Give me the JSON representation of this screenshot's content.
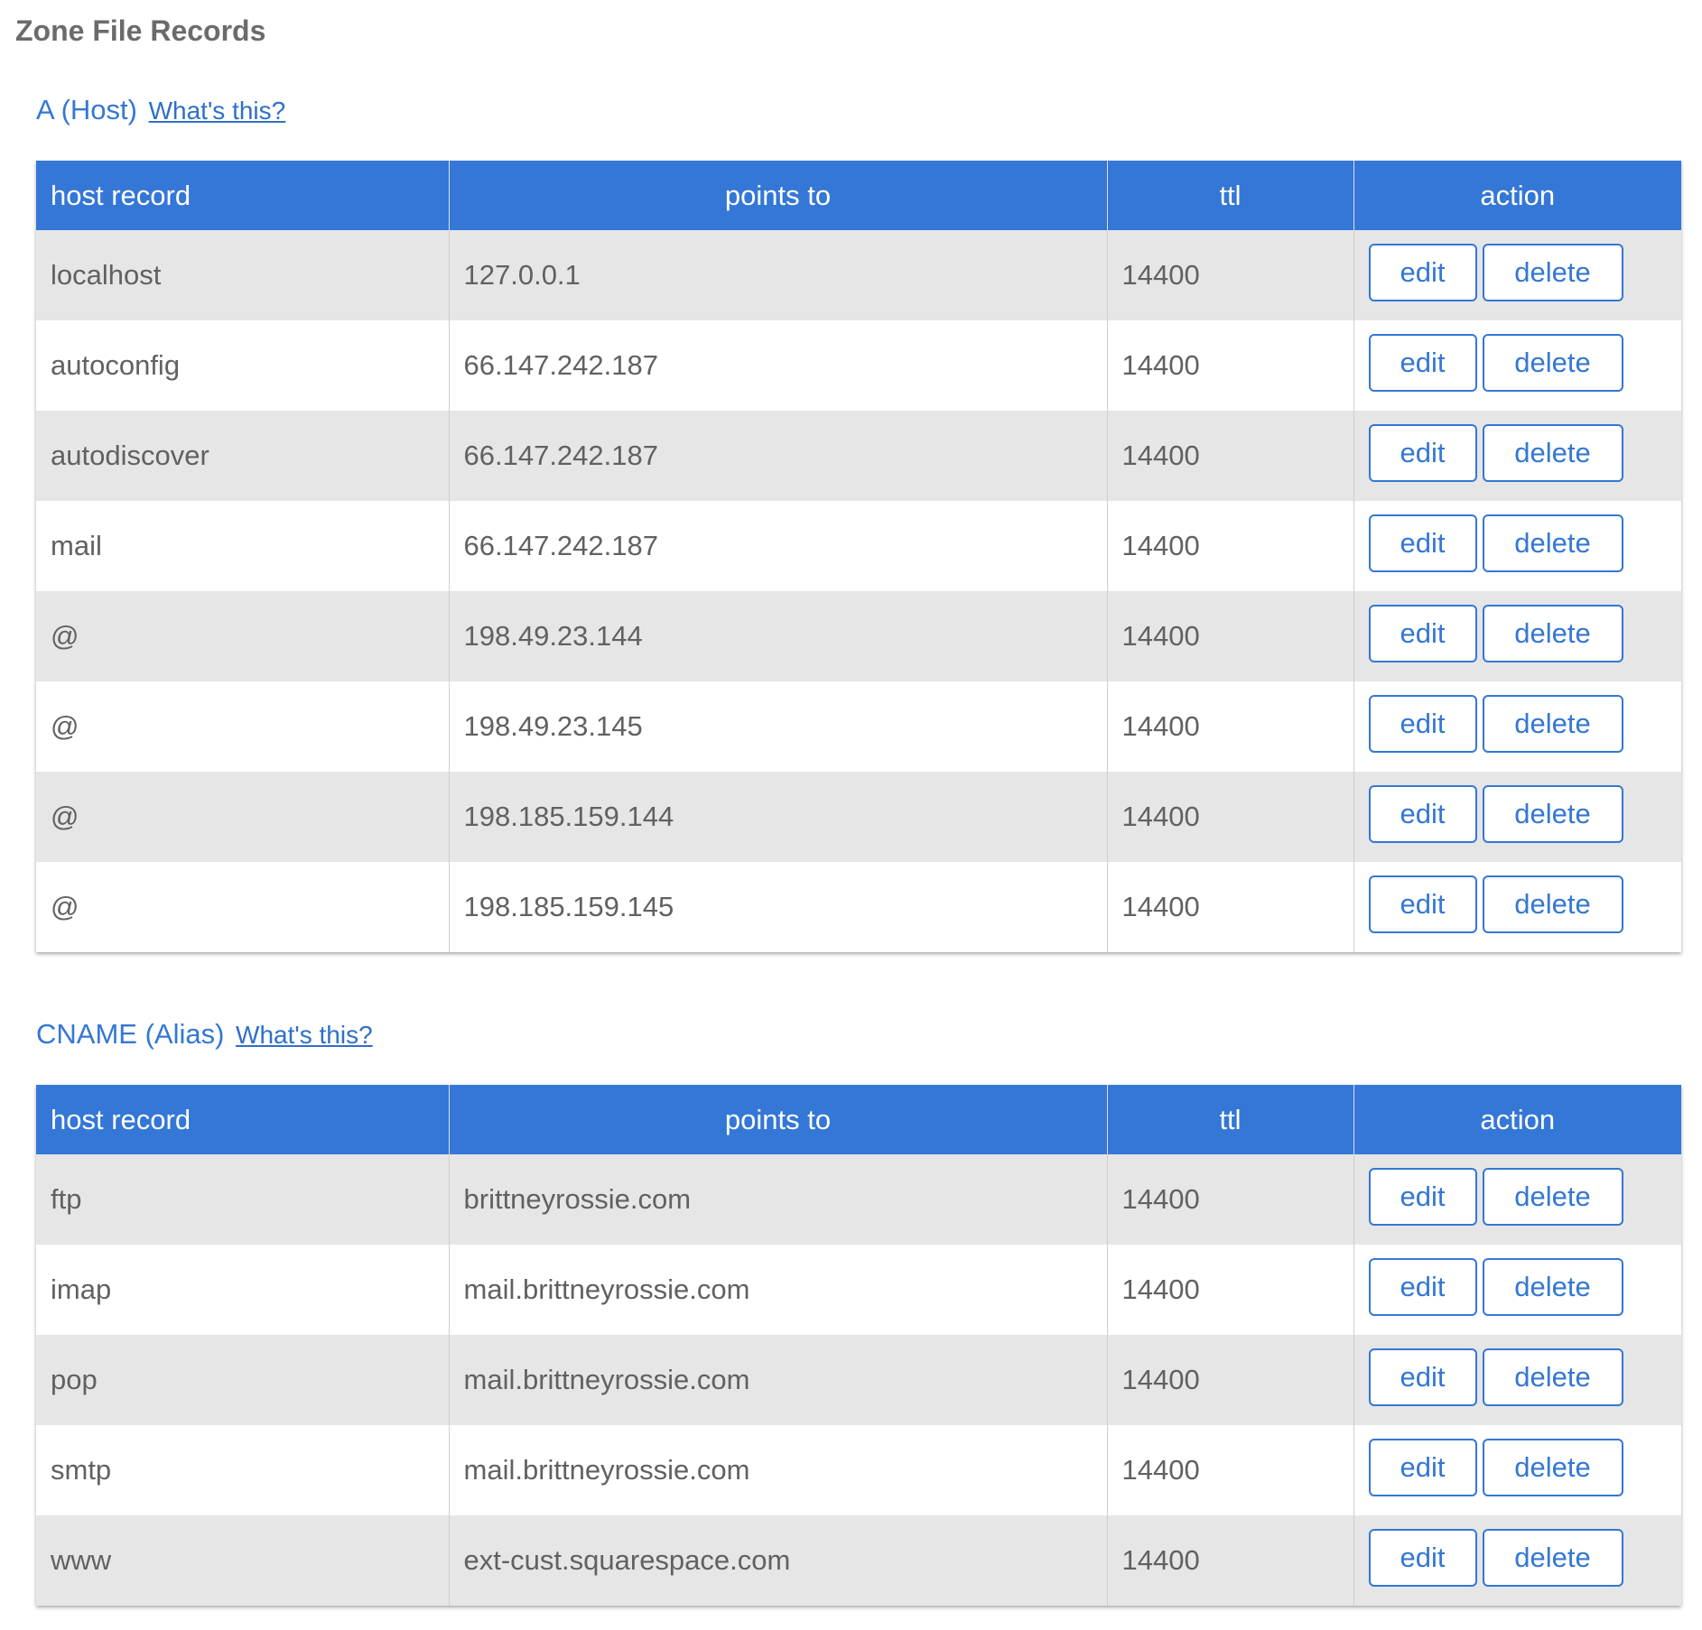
{
  "page": {
    "title": "Zone File Records"
  },
  "columns": {
    "host": "host record",
    "points_to": "points to",
    "ttl": "ttl",
    "action": "action"
  },
  "buttons": {
    "edit": "edit",
    "delete": "delete"
  },
  "sections": [
    {
      "title": "A (Host)",
      "help_link": "What's this?",
      "rows": [
        {
          "host": "localhost",
          "points_to": "127.0.0.1",
          "ttl": "14400"
        },
        {
          "host": "autoconfig",
          "points_to": "66.147.242.187",
          "ttl": "14400"
        },
        {
          "host": "autodiscover",
          "points_to": "66.147.242.187",
          "ttl": "14400"
        },
        {
          "host": "mail",
          "points_to": "66.147.242.187",
          "ttl": "14400"
        },
        {
          "host": "@",
          "points_to": "198.49.23.144",
          "ttl": "14400"
        },
        {
          "host": "@",
          "points_to": "198.49.23.145",
          "ttl": "14400"
        },
        {
          "host": "@",
          "points_to": "198.185.159.144",
          "ttl": "14400"
        },
        {
          "host": "@",
          "points_to": "198.185.159.145",
          "ttl": "14400"
        }
      ]
    },
    {
      "title": "CNAME (Alias)",
      "help_link": "What's this?",
      "rows": [
        {
          "host": "ftp",
          "points_to": "brittneyrossie.com",
          "ttl": "14400"
        },
        {
          "host": "imap",
          "points_to": "mail.brittneyrossie.com",
          "ttl": "14400"
        },
        {
          "host": "pop",
          "points_to": "mail.brittneyrossie.com",
          "ttl": "14400"
        },
        {
          "host": "smtp",
          "points_to": "mail.brittneyrossie.com",
          "ttl": "14400"
        },
        {
          "host": "www",
          "points_to": "ext-cust.squarespace.com",
          "ttl": "14400"
        }
      ]
    }
  ],
  "colors": {
    "accent": "#3477d6",
    "row_alt": "#e6e6e6",
    "text": "#616161"
  }
}
